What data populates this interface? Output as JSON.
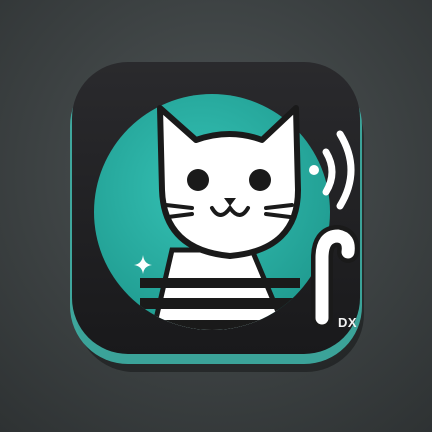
{
  "app_icon": {
    "icon_name": "cat-sound-app-icon",
    "badge_label": "DX",
    "colors": {
      "background": "#3c4142",
      "tile": "#1e1e20",
      "tile_rim": "#3fb8ad",
      "circle": "#2bb0a4",
      "cat_fill": "#ffffff",
      "cat_outline": "#1a1a1a",
      "stripes": "#1a1a1a"
    }
  }
}
